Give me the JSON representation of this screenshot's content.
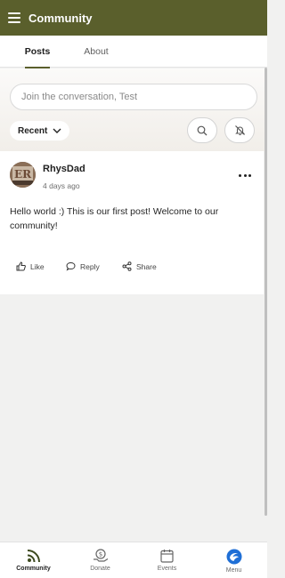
{
  "app_bar": {
    "title": "Community"
  },
  "tabs": [
    {
      "label": "Posts"
    },
    {
      "label": "About"
    }
  ],
  "compose": {
    "placeholder": "Join the conversation, Test"
  },
  "filter": {
    "sort_label": "Recent"
  },
  "post": {
    "author": "RhysDad",
    "time": "4 days ago",
    "body": "Hello world :) This is our first post! Welcome to our community!",
    "avatar_text": "ER",
    "actions": {
      "like": "Like",
      "reply": "Reply",
      "share": "Share"
    }
  },
  "bottom_nav": [
    {
      "label": "Community",
      "icon": "rss-icon"
    },
    {
      "label": "Donate",
      "icon": "donate-icon"
    },
    {
      "label": "Events",
      "icon": "calendar-icon"
    },
    {
      "label": "Menu",
      "icon": "brand-logo-icon"
    }
  ],
  "colors": {
    "brand": "#5a5f2c",
    "menu_logo": "#1f6fd6"
  }
}
